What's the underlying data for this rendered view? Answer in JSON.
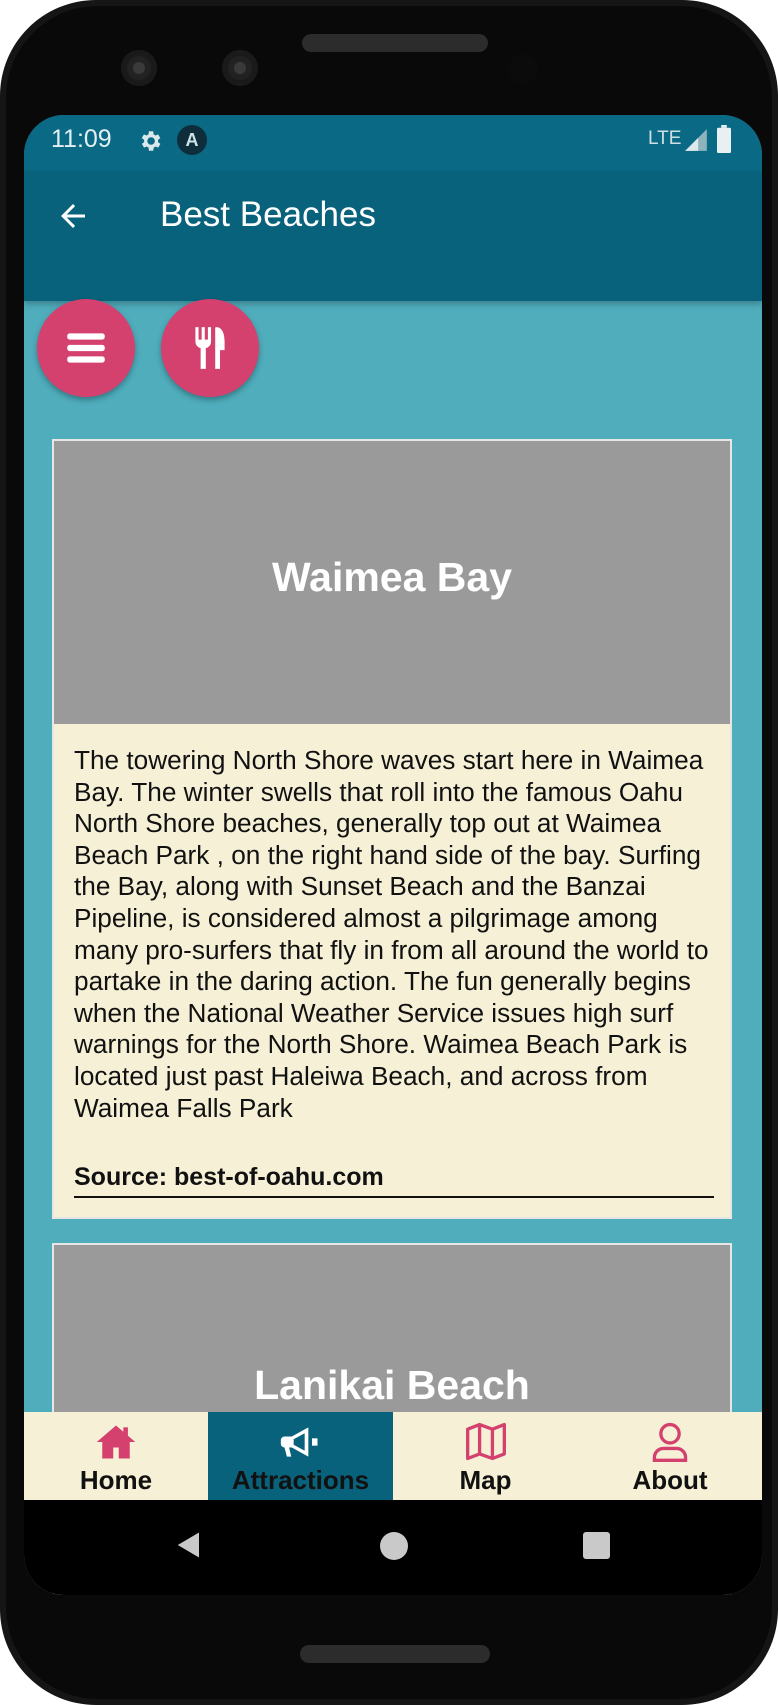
{
  "status_bar": {
    "time": "11:09",
    "network": "LTE"
  },
  "app_bar": {
    "title": "Best Beaches"
  },
  "fabs": {
    "menu_icon": "menu-icon",
    "food_icon": "fork-knife-icon",
    "color": "#d4416f"
  },
  "cards": [
    {
      "title": "Waimea Bay",
      "description": "The towering North Shore waves start here in Waimea Bay. The winter swells that roll into the famous Oahu North Shore beaches, generally top out at Waimea Beach Park , on the right hand side of the bay. Surfing the Bay, along with Sunset Beach and the Banzai Pipeline, is considered almost a pilgrimage among many pro-surfers that fly in from all around the world to partake in the daring action. The fun generally begins when the National Weather Service issues high surf warnings for the North Shore. Waimea Beach Park is located just past Haleiwa Beach, and across from Waimea Falls Park",
      "source": "Source: best-of-oahu.com"
    },
    {
      "title": "Lanikai Beach"
    }
  ],
  "bottom_nav": {
    "tabs": [
      {
        "label": "Home",
        "icon": "home-icon"
      },
      {
        "label": "Attractions",
        "icon": "megaphone-icon",
        "active": true
      },
      {
        "label": "Map",
        "icon": "map-icon"
      },
      {
        "label": "About",
        "icon": "person-icon"
      }
    ]
  },
  "colors": {
    "app_bar": "#08627c",
    "background": "#4fadbc",
    "card": "#f6f0d6",
    "banner": "#9a9a9a",
    "accent": "#d4416f"
  }
}
